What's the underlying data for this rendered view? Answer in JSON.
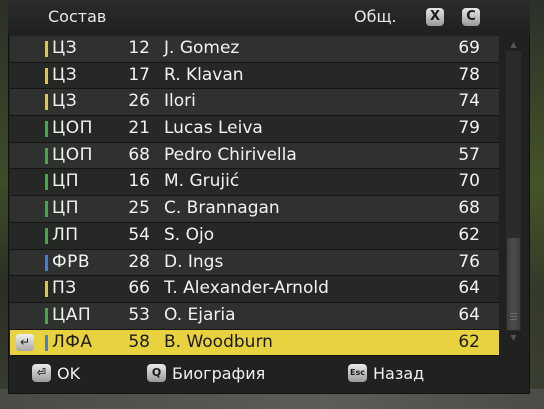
{
  "header": {
    "title": "Состав",
    "ovr_label": "Общ.",
    "key_x": "X",
    "key_c": "C"
  },
  "colors": {
    "cb": "#e7c53a",
    "mid": "#3fae3f",
    "fwd": "#3f7fe0",
    "selected": "#e9d23f"
  },
  "players": [
    {
      "pos": "ЦЗ",
      "bar": "cb",
      "number": "12",
      "name": "J. Gomez",
      "ovr": "69"
    },
    {
      "pos": "ЦЗ",
      "bar": "cb",
      "number": "17",
      "name": "R. Klavan",
      "ovr": "78"
    },
    {
      "pos": "ЦЗ",
      "bar": "cb",
      "number": "26",
      "name": "Ilori",
      "ovr": "74"
    },
    {
      "pos": "ЦОП",
      "bar": "mid",
      "number": "21",
      "name": "Lucas Leiva",
      "ovr": "79"
    },
    {
      "pos": "ЦОП",
      "bar": "mid",
      "number": "68",
      "name": "Pedro Chirivella",
      "ovr": "57"
    },
    {
      "pos": "ЦП",
      "bar": "mid",
      "number": "16",
      "name": "M. Grujić",
      "ovr": "70"
    },
    {
      "pos": "ЦП",
      "bar": "mid",
      "number": "25",
      "name": "C. Brannagan",
      "ovr": "68"
    },
    {
      "pos": "ЛП",
      "bar": "mid",
      "number": "54",
      "name": "S. Ojo",
      "ovr": "62"
    },
    {
      "pos": "ФРВ",
      "bar": "fwd",
      "number": "28",
      "name": "D. Ings",
      "ovr": "76"
    },
    {
      "pos": "ПЗ",
      "bar": "cb",
      "number": "66",
      "name": "T. Alexander-Arnold",
      "ovr": "64"
    },
    {
      "pos": "ЦАП",
      "bar": "mid",
      "number": "53",
      "name": "O. Ejaria",
      "ovr": "64"
    },
    {
      "pos": "ЛФА",
      "bar": "fwd",
      "number": "58",
      "name": "B. Woodburn",
      "ovr": "62",
      "selected": true,
      "icon": "enter-key-icon"
    }
  ],
  "footer": {
    "ok": {
      "key": "⏎",
      "label": "OK"
    },
    "bio": {
      "key": "Q",
      "label": "Биография"
    },
    "back": {
      "key": "Esc",
      "label": "Назад"
    }
  }
}
